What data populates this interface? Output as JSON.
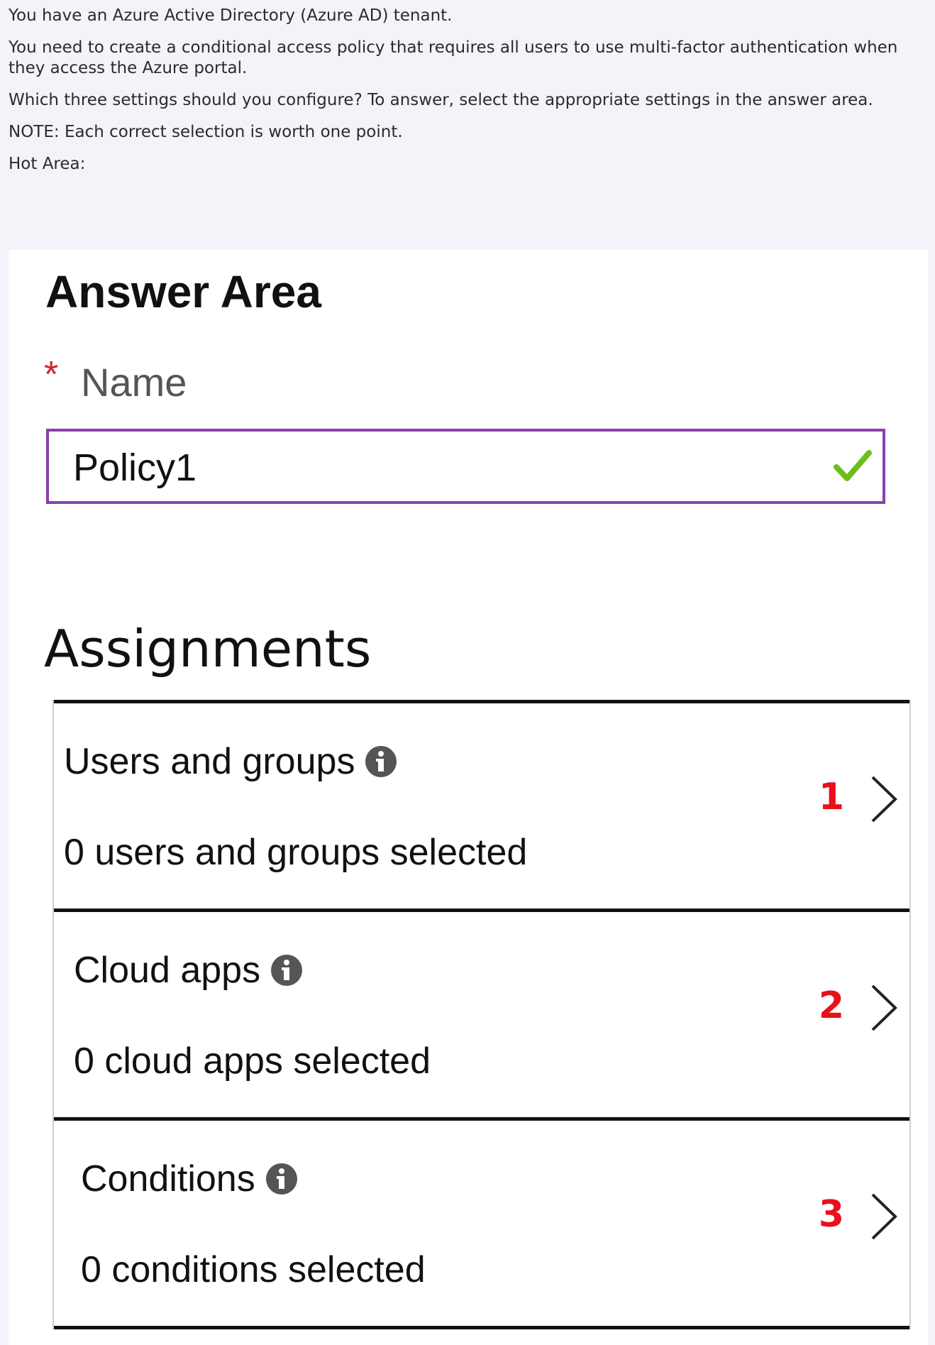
{
  "question": {
    "lines": [
      "You have an Azure Active Directory (Azure AD) tenant.",
      "You need to create a conditional access policy that requires all users to use multi-factor authentication when they access the Azure portal.",
      "Which three settings should you configure? To answer, select the appropriate settings in the answer area.",
      "NOTE: Each correct selection is worth one point.",
      "Hot Area:"
    ]
  },
  "answer_area": {
    "title": "Answer Area",
    "name_field": {
      "required_marker": "*",
      "label": "Name",
      "value": "Policy1",
      "valid_icon": "check-icon"
    },
    "assignments": {
      "heading": "Assignments",
      "items": [
        {
          "title": "Users and groups",
          "summary": "0 users and groups selected",
          "number": "1"
        },
        {
          "title": "Cloud apps",
          "summary": "0 cloud apps selected",
          "number": "2"
        },
        {
          "title": "Conditions",
          "summary": "0 conditions selected",
          "number": "3"
        }
      ]
    }
  },
  "colors": {
    "page_background": "#f3f3f9",
    "input_border": "#8a3fb0",
    "check": "#6bbd1c",
    "number": "#e8101a",
    "asterisk": "#d0242a"
  }
}
